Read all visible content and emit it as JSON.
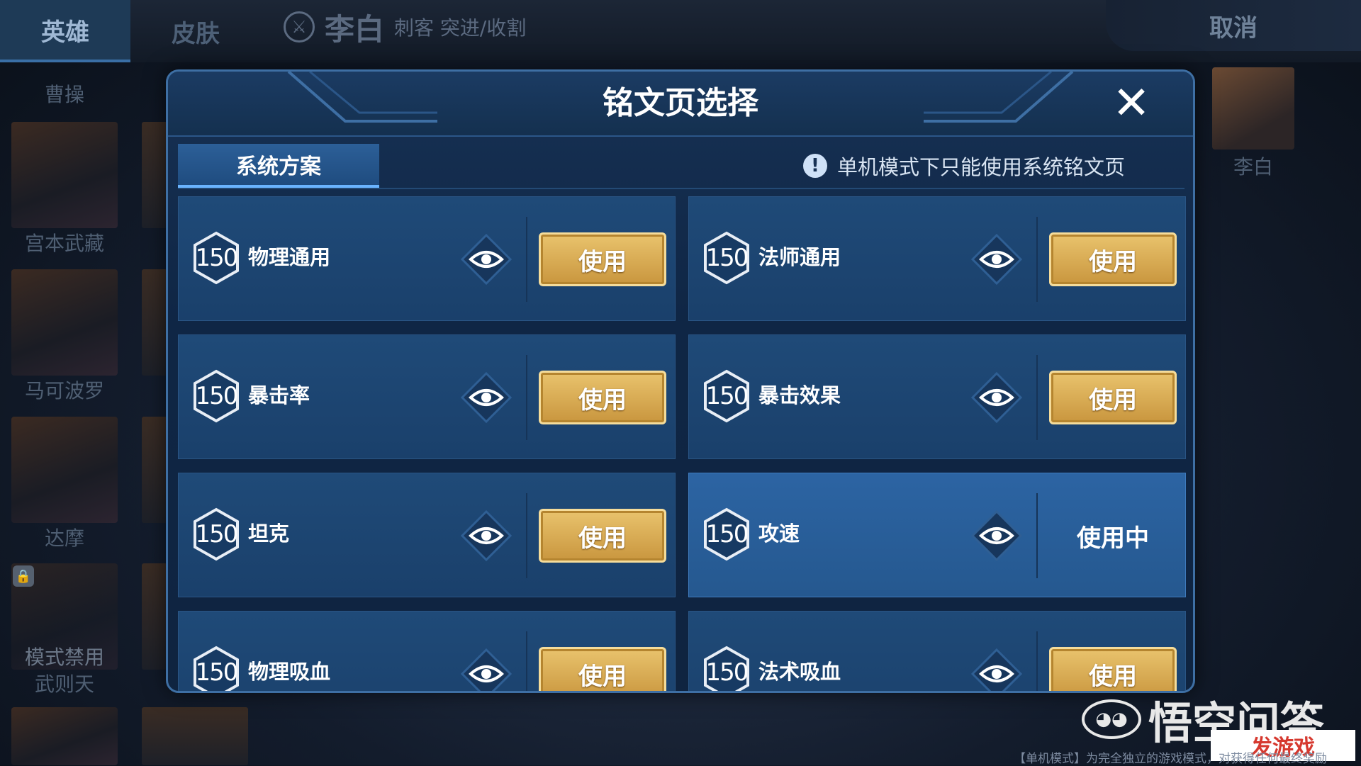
{
  "background": {
    "tabs": [
      "英雄",
      "皮肤"
    ],
    "hero_name": "李白",
    "hero_role": "刺客 突进/收割",
    "cancel_label": "取消",
    "hero_list": [
      "曹操",
      "宫本武藏",
      "马可波罗",
      "达摩",
      "武则天"
    ],
    "mode_banned_label": "模式禁用",
    "selected_hero": "李白",
    "footer": "【单机模式】为完全独立的游戏模式，对获得任何最终奖励"
  },
  "modal": {
    "title": "铭文页选择",
    "tab_label": "系统方案",
    "notice": "单机模式下只能使用系统铭文页",
    "use_label": "使用",
    "in_use_label": "使用中",
    "pages": [
      {
        "level": "150",
        "name": "物理通用",
        "status": "use"
      },
      {
        "level": "150",
        "name": "法师通用",
        "status": "use"
      },
      {
        "level": "150",
        "name": "暴击率",
        "status": "use"
      },
      {
        "level": "150",
        "name": "暴击效果",
        "status": "use"
      },
      {
        "level": "150",
        "name": "坦克",
        "status": "use"
      },
      {
        "level": "150",
        "name": "攻速",
        "status": "in_use"
      },
      {
        "level": "150",
        "name": "物理吸血",
        "status": "use"
      },
      {
        "level": "150",
        "name": "法术吸血",
        "status": "use"
      }
    ]
  },
  "watermark": {
    "brand": "悟空问答",
    "site": "发游戏"
  },
  "icons": [
    "close-icon",
    "info-icon",
    "eye-icon",
    "level-hexagon-icon",
    "lock-icon",
    "hero-role-icon"
  ],
  "colors": {
    "accent": "#6ab4ff",
    "button_gold": "#d9ab55",
    "modal_bg": "#0f2645",
    "card_bg": "#1f4a78",
    "card_active": "#2c64a3"
  }
}
